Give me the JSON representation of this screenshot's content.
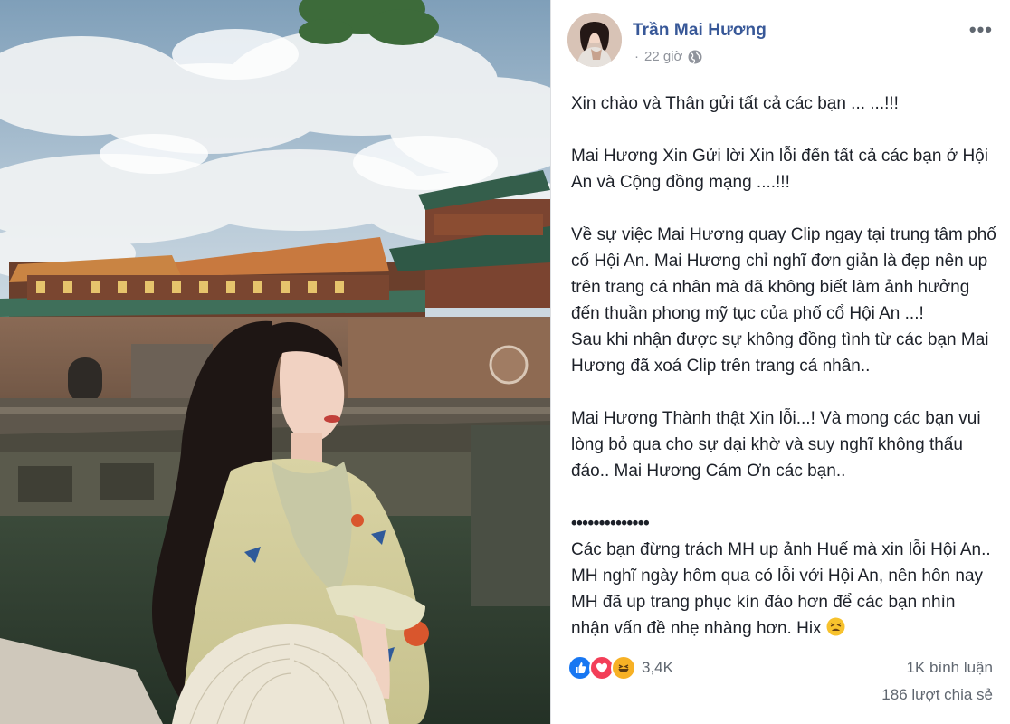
{
  "post": {
    "author": "Trần Mai Hương",
    "time": "22 giờ",
    "separator": "·",
    "more_label": "•••",
    "paragraphs": {
      "p1": "Xin chào và Thân gửi tất cả các bạn ... ...!!!",
      "p2": "Mai Hương Xin Gửi lời Xin lỗi đến tất cả các bạn ở Hội An và Cộng đồng mạng ....!!!",
      "p3a": "Về sự việc Mai Hương quay Clip ngay tại trung tâm phố cổ Hội An. Mai Hương chỉ nghĩ đơn giản là đẹp nên up trên trang cá nhân mà đã không biết làm ảnh hưởng đến thuần phong mỹ tục của phố cổ Hội An ...!",
      "p3b": "Sau khi nhận được sự không đồng tình từ các bạn Mai Hương đã xoá Clip trên trang cá nhân..",
      "p4": "Mai Hương Thành thật Xin lỗi...! Và mong các bạn vui lòng bỏ qua cho sự dại khờ và suy nghĩ không thấu đáo.. Mai Hương Cám Ơn các bạn..",
      "divider": "••••••••••••••",
      "p5": "Các bạn đừng trách MH up ảnh Huế mà xin lỗi Hội An.. MH nghĩ ngày hôm qua có lỗi với Hội An, nên hôn nay MH đã up trang phục kín đáo hơn để các bạn nhìn nhận vấn đề nhẹ nhàng hơn. Hix"
    },
    "reactions": {
      "icons": [
        "like-icon",
        "love-icon",
        "haha-icon"
      ],
      "count": "3,4K"
    },
    "comments": "1K bình luận",
    "shares": "186 lượt chia sẻ"
  },
  "colors": {
    "author": "#385898",
    "meta": "#90949c",
    "like": "#1877f2",
    "love": "#f33e58",
    "haha": "#f7b125"
  }
}
